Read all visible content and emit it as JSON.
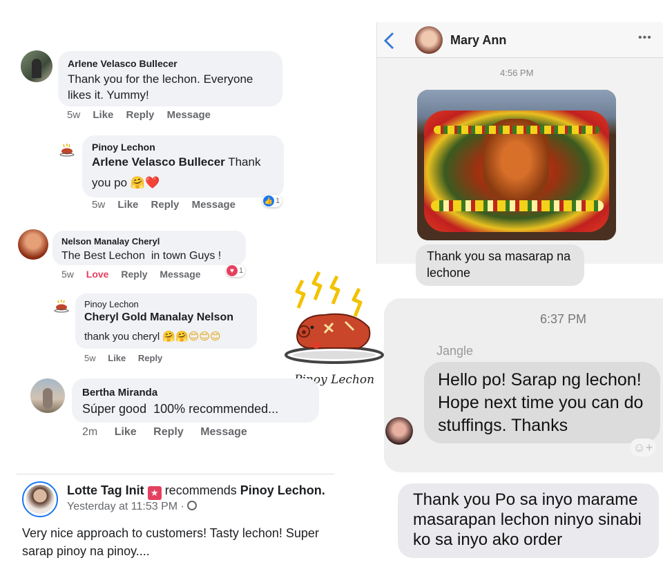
{
  "comments": [
    {
      "name": "Arlene Velasco Bullecer",
      "text_line1": "Thank you for the lechon. Everyone",
      "text_line2": "likes it. Yummy!",
      "time": "5w",
      "actions": [
        "Like",
        "Reply",
        "Message"
      ]
    },
    {
      "name": "Pinoy Lechon",
      "mention": "Arlene Velasco Bullecer",
      "text_tail": " Thank",
      "text_line2": "you po",
      "emoji": "🤗❤️",
      "time": "5w",
      "actions": [
        "Like",
        "Reply",
        "Message"
      ],
      "reaction_count": "1"
    },
    {
      "name": "Nelson Manalay Cheryl",
      "text": "The Best Lechon  in town Guys !",
      "time": "5w",
      "love": "Love",
      "actions": [
        "Reply",
        "Message"
      ],
      "reaction_count": "1"
    },
    {
      "name": "Pinoy Lechon",
      "mention": "Cheryl Gold Manalay Nelson",
      "text": "thank you cheryl",
      "emoji": "🤗🤗😊😊😊",
      "time": "5w",
      "actions": [
        "Like",
        "Reply"
      ]
    },
    {
      "name": "Bertha Miranda",
      "text": "Súper good  100% recommended...",
      "time": "2m",
      "actions": [
        "Like",
        "Reply",
        "Message"
      ]
    }
  ],
  "logo_caption": "Pinoy Lechon",
  "post": {
    "author": "Lotte Tag Init",
    "recommends": "recommends",
    "page": "Pinoy Lechon.",
    "time": "Yesterday at 11:53 PM · ",
    "text_line1": "Very nice approach to customers! Tasty lechon! Super",
    "text_line2": "sarap pinoy na pinoy...."
  },
  "messenger": {
    "back_icon": "chevron-left-icon",
    "contact": "Mary Ann",
    "more": "•••",
    "timestamp": "4:56 PM",
    "message_line1": "Thank you sa masarap na",
    "message_line2": "lechone"
  },
  "chat2": {
    "timestamp": "6:37 PM",
    "sender": "Jangle",
    "line1": "Hello po! Sarap ng lechon!",
    "line2": "Hope next time you can do",
    "line3": "stuffings. Thanks"
  },
  "chat3": {
    "line1": "Thank you Po sa inyo marame",
    "line2": "masarapan lechon ninyo sinabi",
    "line3": "ko sa inyo ako order"
  },
  "colors": {
    "accent": "#1877f2",
    "love": "#e4405f",
    "bubble": "#f0f2f5",
    "messenger_back": "#3a7bd5"
  }
}
